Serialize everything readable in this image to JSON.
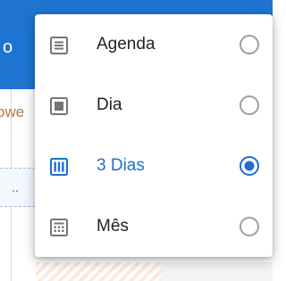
{
  "background": {
    "header_fragment": "o",
    "body_fragment": "owe"
  },
  "menu": {
    "items": [
      {
        "label": "Agenda",
        "icon": "agenda-view-icon",
        "selected": false
      },
      {
        "label": "Dia",
        "icon": "day-view-icon",
        "selected": false
      },
      {
        "label": "3 Dias",
        "icon": "three-day-view-icon",
        "selected": true
      },
      {
        "label": "Mês",
        "icon": "month-view-icon",
        "selected": false
      }
    ]
  },
  "colors": {
    "accent": "#1e6fd1",
    "header": "#1e74d0",
    "icon_gray": "#757575",
    "radio_gray": "#9e9e9e"
  }
}
